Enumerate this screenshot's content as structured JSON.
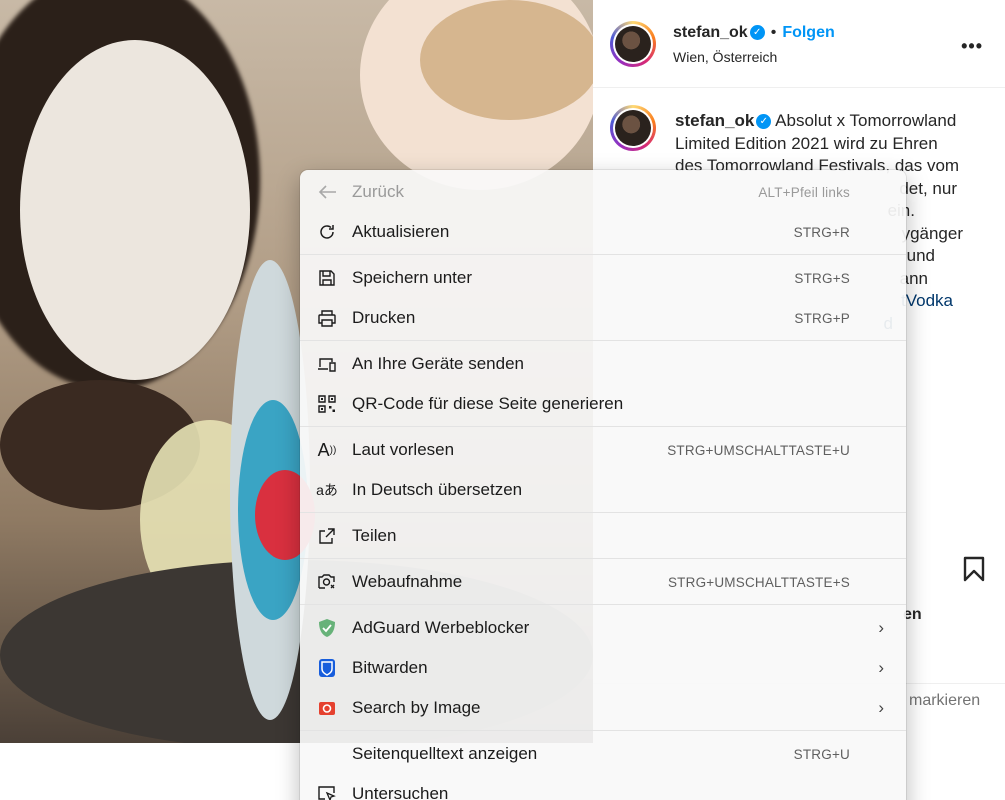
{
  "post": {
    "username": "stefan_ok",
    "verified_symbol": "✓",
    "dot": "•",
    "follow_label": "Folgen",
    "location": "Wien, Österreich",
    "more_label": "•••",
    "caption_lines": [
      "Absolut x Tomorrowland",
      "Limited Edition 2021 wird zu Ehren",
      "des Tomorrowland Festivals, das vom",
      "det, nur",
      "ein.",
      "ygänger",
      "und",
      "ann"
    ],
    "hashtags": [
      "tVodka",
      "d"
    ],
    "likes_partial": "en",
    "comment_placeholder_partial": "markieren"
  },
  "context_menu": {
    "items": [
      {
        "icon": "back-arrow-icon",
        "glyph": "←",
        "label": "Zurück",
        "shortcut": "ALT+Pfeil links",
        "disabled": true
      },
      {
        "icon": "refresh-icon",
        "glyph": "↻",
        "label": "Aktualisieren",
        "shortcut": "STRG+R"
      },
      {
        "icon": "save-icon",
        "glyph": "🖫",
        "label": "Speichern unter",
        "shortcut": "STRG+S"
      },
      {
        "icon": "printer-icon",
        "glyph": "⎙",
        "label": "Drucken",
        "shortcut": "STRG+P"
      },
      {
        "icon": "devices-icon",
        "glyph": "▭",
        "label": "An Ihre Geräte senden",
        "shortcut": ""
      },
      {
        "icon": "qr-code-icon",
        "glyph": "▦",
        "label": "QR-Code für diese Seite generieren",
        "shortcut": ""
      },
      {
        "icon": "read-aloud-icon",
        "glyph": "A",
        "label": "Laut vorlesen",
        "shortcut": "STRG+UMSCHALTTASTE+U"
      },
      {
        "icon": "translate-icon",
        "glyph": "aあ",
        "label": "In Deutsch übersetzen",
        "shortcut": ""
      },
      {
        "icon": "share-icon",
        "glyph": "⇪",
        "label": "Teilen",
        "shortcut": ""
      },
      {
        "icon": "web-capture-icon",
        "glyph": "◳",
        "label": "Webaufnahme",
        "shortcut": "STRG+UMSCHALTTASTE+S"
      },
      {
        "icon": "adguard-icon",
        "glyph": "✔",
        "label": "AdGuard Werbeblocker",
        "submenu": "›"
      },
      {
        "icon": "bitwarden-icon",
        "glyph": "U",
        "label": "Bitwarden",
        "submenu": "›"
      },
      {
        "icon": "search-by-image-icon",
        "glyph": "◉",
        "label": "Search by Image",
        "submenu": "›"
      },
      {
        "icon": "",
        "glyph": "",
        "label": "Seitenquelltext anzeigen",
        "shortcut": "STRG+U"
      },
      {
        "icon": "inspect-icon",
        "glyph": "⬚",
        "label": "Untersuchen",
        "shortcut": ""
      }
    ]
  },
  "colors": {
    "accent_blue": "#0095f6",
    "hashtag_blue": "#00376b",
    "adguard_green": "#67b279",
    "bitwarden_blue": "#175ddc",
    "search_image_red": "#e5412f"
  }
}
